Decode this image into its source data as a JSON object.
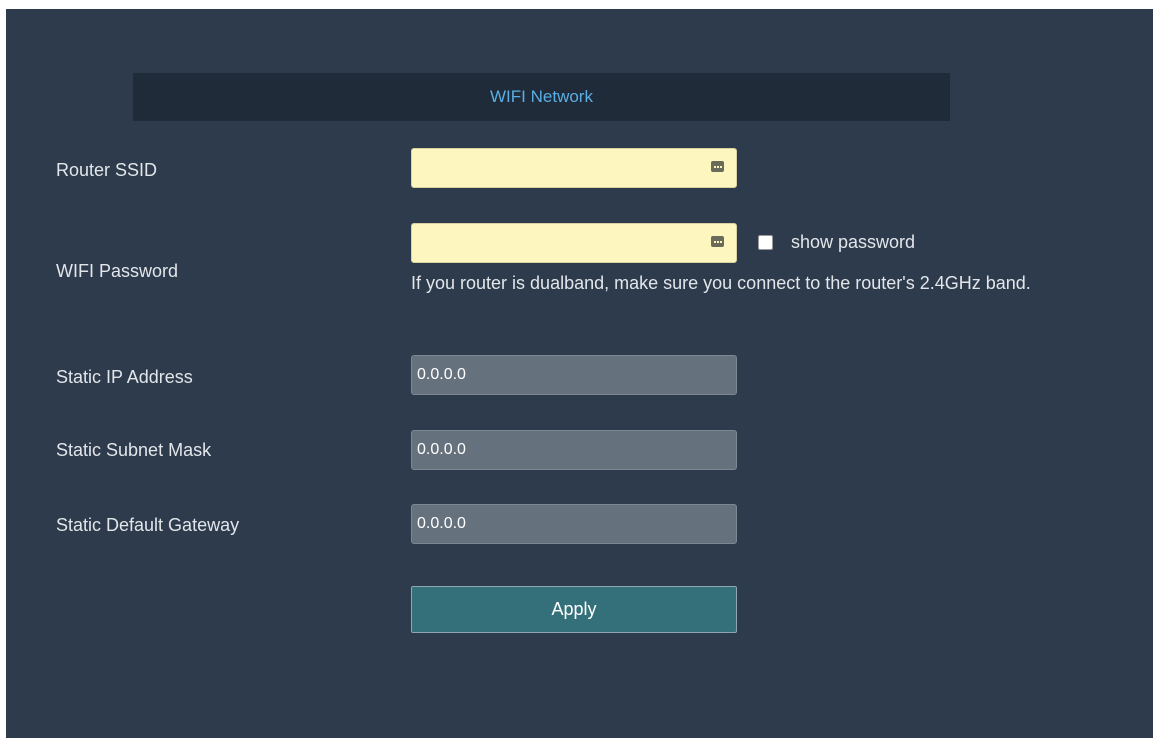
{
  "section": {
    "title": "WIFI Network"
  },
  "fields": {
    "router_ssid": {
      "label": "Router SSID",
      "value": ""
    },
    "wifi_password": {
      "label": "WIFI Password",
      "value": "",
      "show_password_label": "show password",
      "show_password_checked": false,
      "hint": "If you router is dualband, make sure you connect to the router's 2.4GHz band."
    },
    "static_ip": {
      "label": "Static IP Address",
      "value": "0.0.0.0"
    },
    "subnet_mask": {
      "label": "Static Subnet Mask",
      "value": "0.0.0.0"
    },
    "default_gateway": {
      "label": "Static Default Gateway",
      "value": "0.0.0.0"
    }
  },
  "actions": {
    "apply_label": "Apply"
  },
  "icons": {
    "field_key": "password-manager-key-icon"
  },
  "colors": {
    "background": "#2d3b4c",
    "header_bg": "#1f2b39",
    "header_text": "#5aaee4",
    "input_yellow": "#fdf6bf",
    "input_gray": "#66717e",
    "apply_bg": "#33707a"
  }
}
